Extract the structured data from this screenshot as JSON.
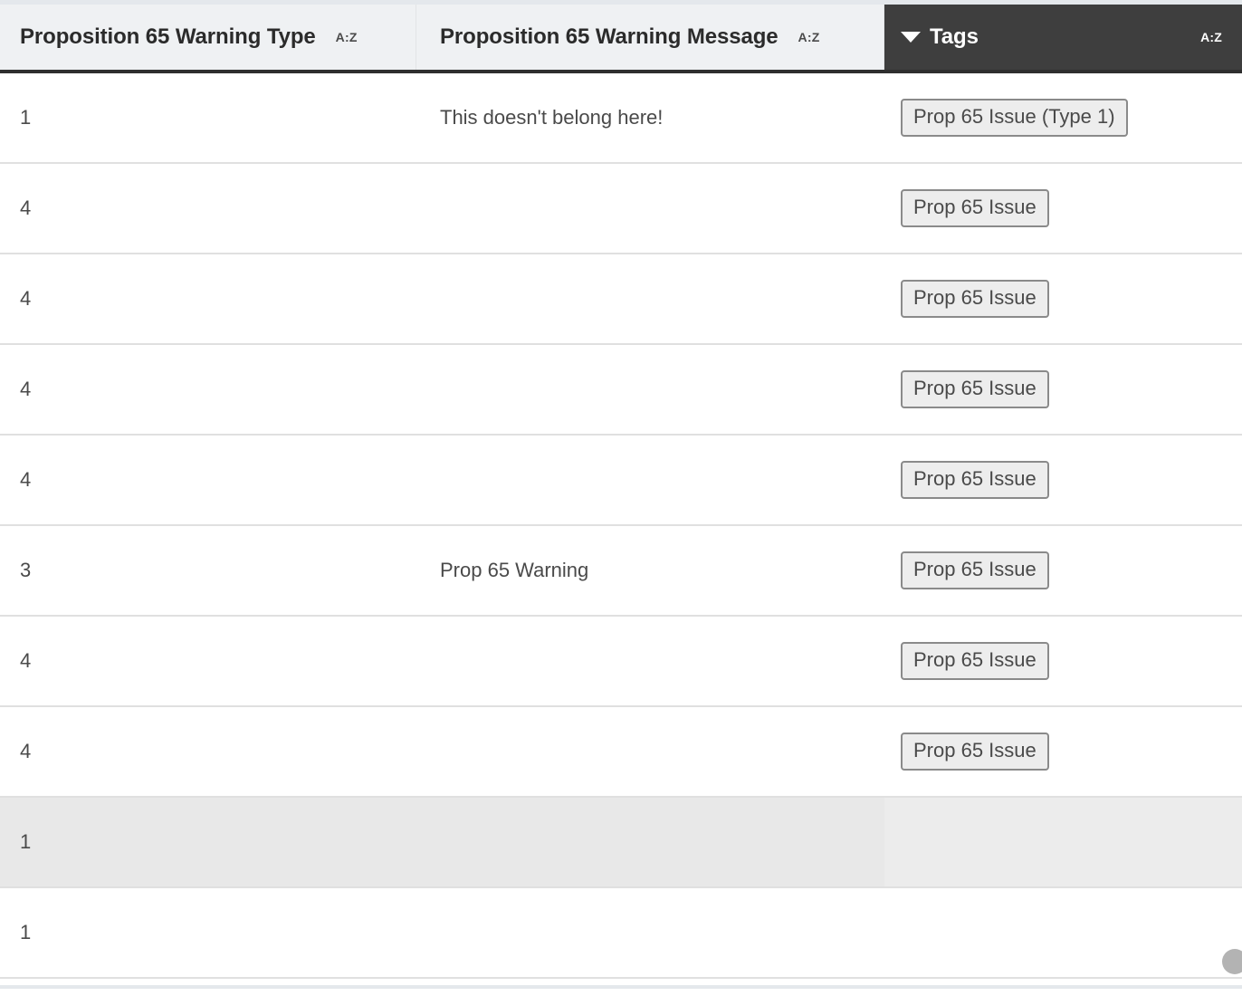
{
  "table": {
    "columns": [
      {
        "label": "Proposition 65 Warning Type",
        "sort": "A:Z",
        "active": false
      },
      {
        "label": "Proposition 65 Warning Message",
        "sort": "A:Z",
        "active": false
      },
      {
        "label": "Tags",
        "sort": "A:Z",
        "active": true
      }
    ],
    "rows": [
      {
        "type": "1",
        "message": "This doesn't belong here!",
        "tag": "Prop 65 Issue (Type 1)",
        "selected": false
      },
      {
        "type": "4",
        "message": "",
        "tag": "Prop 65 Issue",
        "selected": false
      },
      {
        "type": "4",
        "message": "",
        "tag": "Prop 65 Issue",
        "selected": false
      },
      {
        "type": "4",
        "message": "",
        "tag": "Prop 65 Issue",
        "selected": false
      },
      {
        "type": "4",
        "message": "",
        "tag": "Prop 65 Issue",
        "selected": false
      },
      {
        "type": "3",
        "message": "Prop 65 Warning",
        "tag": "Prop 65 Issue",
        "selected": false
      },
      {
        "type": "4",
        "message": "",
        "tag": "Prop 65 Issue",
        "selected": false
      },
      {
        "type": "4",
        "message": "",
        "tag": "Prop 65 Issue",
        "selected": false
      },
      {
        "type": "1",
        "message": "",
        "tag": "",
        "selected": true
      },
      {
        "type": "1",
        "message": "",
        "tag": "",
        "selected": false
      }
    ]
  },
  "colors": {
    "header_background": "#eff1f3",
    "active_header_background": "#3e3e3e",
    "selected_row_background": "#e8e8e8",
    "tag_background": "#ededed",
    "tag_border": "#8a8a8a",
    "text": "#4a4a4a"
  }
}
